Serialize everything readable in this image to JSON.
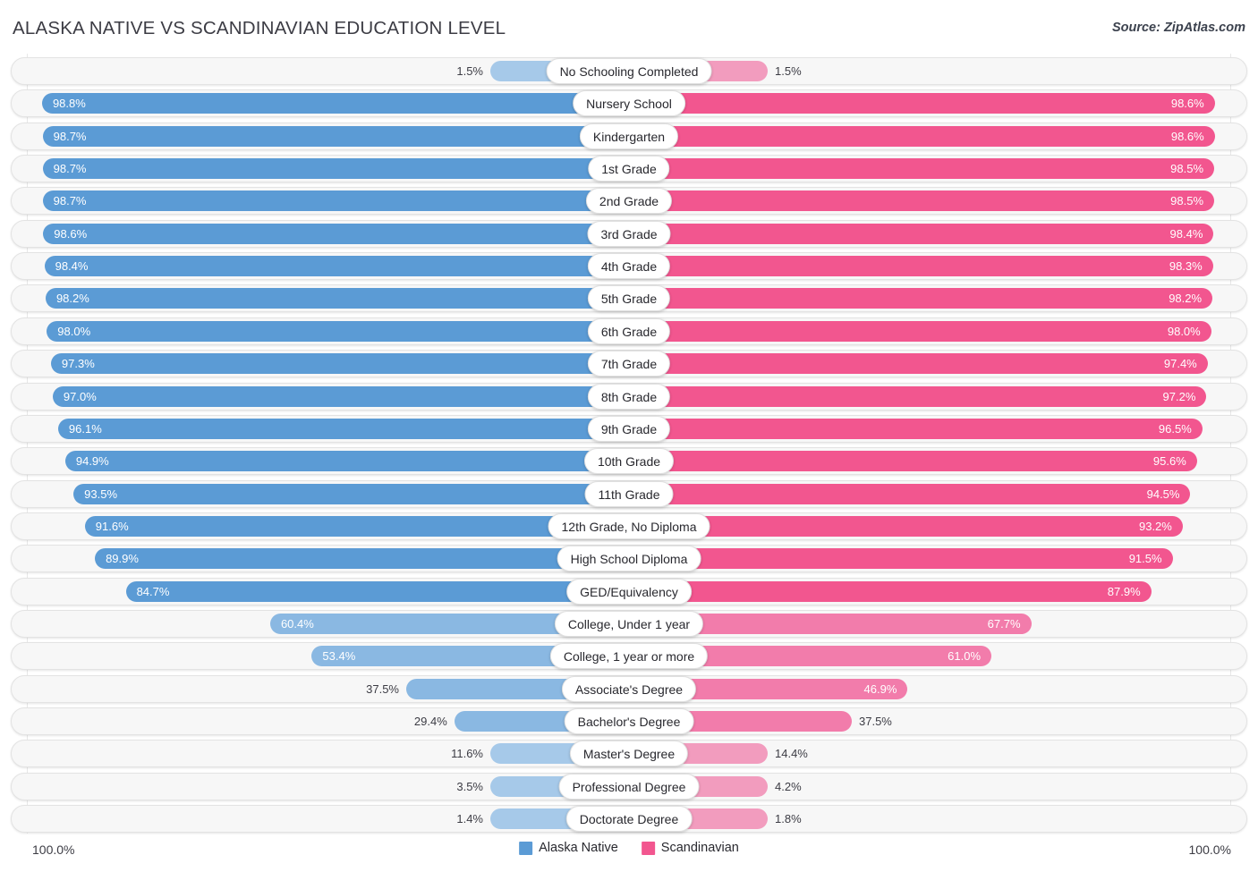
{
  "header": {
    "title": "ALASKA NATIVE VS SCANDINAVIAN EDUCATION LEVEL",
    "source": "Source: ZipAtlas.com"
  },
  "footer": {
    "axis_max_left": "100.0%",
    "axis_max_right": "100.0%",
    "legend": [
      {
        "label": "Alaska Native",
        "color": "#5b9bd5"
      },
      {
        "label": "Scandinavian",
        "color": "#f2568f"
      }
    ]
  },
  "colors": {
    "left_strong": "#5b9bd5",
    "left_pale": "#a6c9e9",
    "right_strong": "#f2568f",
    "right_pale": "#f29cbe",
    "track": "#f7f7f7",
    "text": "#3c3c44"
  },
  "chart_data": {
    "type": "bar",
    "subtype": "diverging-bidirectional",
    "title": "ALASKA NATIVE VS SCANDINAVIAN EDUCATION LEVEL",
    "source": "Source: ZipAtlas.com",
    "xlabel": "",
    "ylabel": "",
    "xlim": [
      0,
      100
    ],
    "unit": "%",
    "grid": false,
    "legend_position": "bottom-center",
    "axis_tick_labels": [
      "100.0%",
      "100.0%"
    ],
    "categories": [
      "No Schooling Completed",
      "Nursery School",
      "Kindergarten",
      "1st Grade",
      "2nd Grade",
      "3rd Grade",
      "4th Grade",
      "5th Grade",
      "6th Grade",
      "7th Grade",
      "8th Grade",
      "9th Grade",
      "10th Grade",
      "11th Grade",
      "12th Grade, No Diploma",
      "High School Diploma",
      "GED/Equivalency",
      "College, Under 1 year",
      "College, 1 year or more",
      "Associate's Degree",
      "Bachelor's Degree",
      "Master's Degree",
      "Professional Degree",
      "Doctorate Degree"
    ],
    "series": [
      {
        "name": "Alaska Native",
        "side": "left",
        "color": "#5b9bd5",
        "values": [
          1.5,
          98.8,
          98.7,
          98.7,
          98.7,
          98.6,
          98.4,
          98.2,
          98.0,
          97.3,
          97.0,
          96.1,
          94.9,
          93.5,
          91.6,
          89.9,
          84.7,
          60.4,
          53.4,
          37.5,
          29.4,
          11.6,
          3.5,
          1.4
        ],
        "labels": [
          "1.5%",
          "98.8%",
          "98.7%",
          "98.7%",
          "98.7%",
          "98.6%",
          "98.4%",
          "98.2%",
          "98.0%",
          "97.3%",
          "97.0%",
          "96.1%",
          "94.9%",
          "93.5%",
          "91.6%",
          "89.9%",
          "84.7%",
          "60.4%",
          "53.4%",
          "37.5%",
          "29.4%",
          "11.6%",
          "3.5%",
          "1.4%"
        ]
      },
      {
        "name": "Scandinavian",
        "side": "right",
        "color": "#f2568f",
        "values": [
          1.5,
          98.6,
          98.6,
          98.5,
          98.5,
          98.4,
          98.3,
          98.2,
          98.0,
          97.4,
          97.2,
          96.5,
          95.6,
          94.5,
          93.2,
          91.5,
          87.9,
          67.7,
          61.0,
          46.9,
          37.5,
          14.4,
          4.2,
          1.8
        ],
        "labels": [
          "1.5%",
          "98.6%",
          "98.6%",
          "98.5%",
          "98.5%",
          "98.4%",
          "98.3%",
          "98.2%",
          "98.0%",
          "97.4%",
          "97.2%",
          "96.5%",
          "95.6%",
          "94.5%",
          "93.2%",
          "91.5%",
          "87.9%",
          "67.7%",
          "61.0%",
          "46.9%",
          "37.5%",
          "14.4%",
          "4.2%",
          "1.8%"
        ]
      }
    ]
  }
}
